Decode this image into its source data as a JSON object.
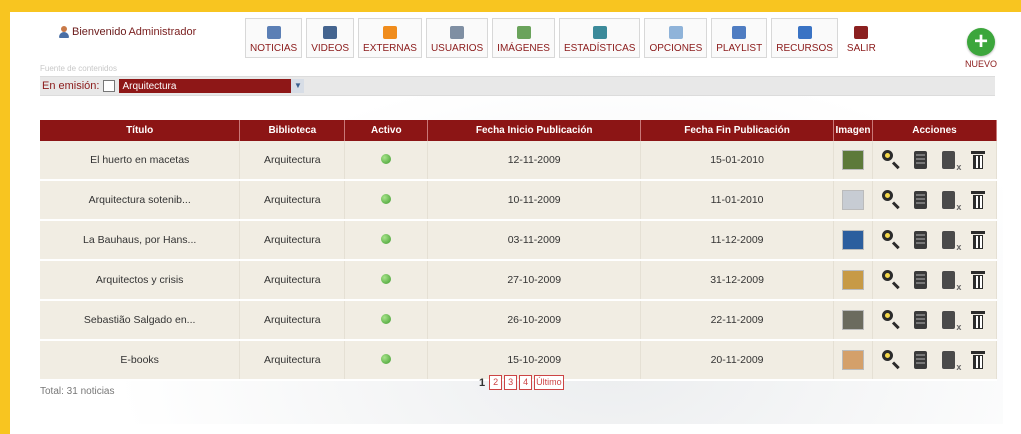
{
  "colors": {
    "frame": "#f8c520",
    "header_bg": "#8c1515",
    "row_bg": "#f1ede3",
    "accent_green": "#3ca63c"
  },
  "header": {
    "welcome_prefix": "Bienvenido",
    "user_name": "Administrador",
    "faint_text": "Fuente de contenidos"
  },
  "nav": [
    {
      "label": "NOTICIAS",
      "icon": "news-icon",
      "color": "#5b7fb5"
    },
    {
      "label": "VIDEOS",
      "icon": "video-icon",
      "color": "#44648f"
    },
    {
      "label": "EXTERNAS",
      "icon": "rss-icon",
      "color": "#f08c1c"
    },
    {
      "label": "USUARIOS",
      "icon": "users-icon",
      "color": "#7f8fa3"
    },
    {
      "label": "IMÁGENES",
      "icon": "images-icon",
      "color": "#6aa35b"
    },
    {
      "label": "ESTADÍSTICAS",
      "icon": "stats-icon",
      "color": "#3b8a9a"
    },
    {
      "label": "OPCIONES",
      "icon": "options-icon",
      "color": "#8fb3d9"
    },
    {
      "label": "PLAYLIST",
      "icon": "playlist-icon",
      "color": "#4f7dc2"
    },
    {
      "label": "RECURSOS",
      "icon": "resources-icon",
      "color": "#3a73c4"
    },
    {
      "label": "SALIR",
      "icon": "exit-icon",
      "color": "#8b2020"
    }
  ],
  "new_button": {
    "label": "NUEVO"
  },
  "filter": {
    "label": "En emisión:",
    "selected": "Arquitectura"
  },
  "table": {
    "columns": [
      "Título",
      "Biblioteca",
      "Activo",
      "Fecha Inicio Publicación",
      "Fecha Fin Publicación",
      "Imagen",
      "Acciones"
    ],
    "rows": [
      {
        "title": "El huerto en macetas",
        "library": "Arquitectura",
        "start": "12-11-2009",
        "end": "15-01-2010",
        "thumb": "#5d7a3a"
      },
      {
        "title": "Arquitectura sotenib...",
        "library": "Arquitectura",
        "start": "10-11-2009",
        "end": "11-01-2010",
        "thumb": "#c7ccd3"
      },
      {
        "title": "La Bauhaus, por Hans...",
        "library": "Arquitectura",
        "start": "03-11-2009",
        "end": "11-12-2009",
        "thumb": "#2c5e9e"
      },
      {
        "title": "Arquitectos y crisis",
        "library": "Arquitectura",
        "start": "27-10-2009",
        "end": "31-12-2009",
        "thumb": "#c79a46"
      },
      {
        "title": "Sebastião Salgado en...",
        "library": "Arquitectura",
        "start": "26-10-2009",
        "end": "22-11-2009",
        "thumb": "#6b6b5e"
      },
      {
        "title": "E-books",
        "library": "Arquitectura",
        "start": "15-10-2009",
        "end": "20-11-2009",
        "thumb": "#d4a06a"
      }
    ]
  },
  "footer": {
    "total": "Total: 31 noticias",
    "current_page": "1",
    "pages": [
      "2",
      "3",
      "4",
      "Último"
    ]
  }
}
